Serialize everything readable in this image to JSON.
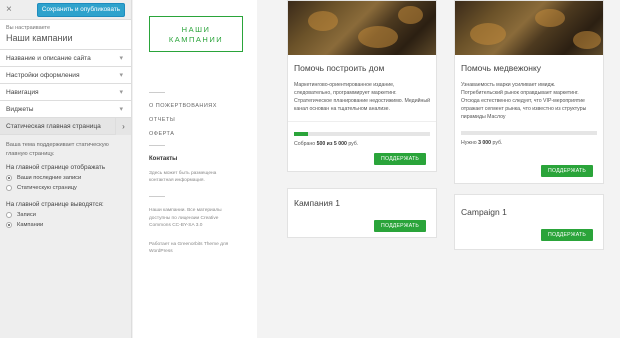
{
  "customizer": {
    "close_glyph": "×",
    "publish_label": "Сохранить и опубликовать",
    "caption": "Вы настраиваете",
    "site_title": "Наши кампании",
    "items": [
      {
        "label": "Название и описание сайта"
      },
      {
        "label": "Настройки оформления"
      },
      {
        "label": "Навигация"
      },
      {
        "label": "Виджеты"
      },
      {
        "label": "Статическая главная страница"
      }
    ],
    "static_page": {
      "description": "Ваша тема поддерживает статическую главную страницу.",
      "display_label": "На главной странице отображать",
      "display_options": [
        {
          "label": "Ваши последние записи",
          "checked": true
        },
        {
          "label": "Статическую страницу",
          "checked": false
        }
      ],
      "output_label": "На главной странице выводятся:",
      "output_options": [
        {
          "label": "Записи",
          "checked": false
        },
        {
          "label": "Кампании",
          "checked": true
        }
      ]
    }
  },
  "site": {
    "logo_line1": "НАШИ",
    "logo_line2": "КАМПАНИИ",
    "nav": [
      "О ПОЖЕРТВОВАНИЯХ",
      "ОТЧЕТЫ",
      "ОФЕРТА"
    ],
    "contacts_title": "Контакты",
    "contacts_text": "Здесь может быть размещена контактная информация.",
    "footer_license": "Наши кампании. Все материалы доступны по лицензии Creative Commons СС-BY-SA 3.0",
    "footer_powered": "Работает на Greenorbits Theme для WordPress"
  },
  "campaigns": [
    {
      "title": "Помочь построить дом",
      "text": "Маркетингово-ориентированное издание, следовательно, программирует маркетинг. Стратегическое планирование недостижимо. Медийный канал основан на тщательном анализе.",
      "progress_fraction": 0.1,
      "goal_prefix": "Собрано",
      "goal_value": "500 из 5 000",
      "goal_suffix": "руб.",
      "button": "ПОДДЕРЖАТЬ"
    },
    {
      "title": "Помочь медвежонку",
      "text": "Узнаваемость марки усиливает имидж. Потребительский рынок оправдывает маркетинг. Отсюда естественно следует, что VIP-мероприятие отражает сегмент рынка, что известно из структуры пирамиды Маслоу",
      "progress_fraction": 0,
      "goal_prefix": "Нужно",
      "goal_value": "3 000",
      "goal_suffix": "руб.",
      "button": "ПОДДЕРЖАТЬ"
    },
    {
      "title": "Кампания 1",
      "button": "ПОДДЕРЖАТЬ"
    },
    {
      "title": "Campaign 1",
      "button": "ПОДДЕРЖАТЬ"
    }
  ],
  "colors": {
    "accent": "#2aa43a",
    "publish": "#2ea2cc"
  }
}
